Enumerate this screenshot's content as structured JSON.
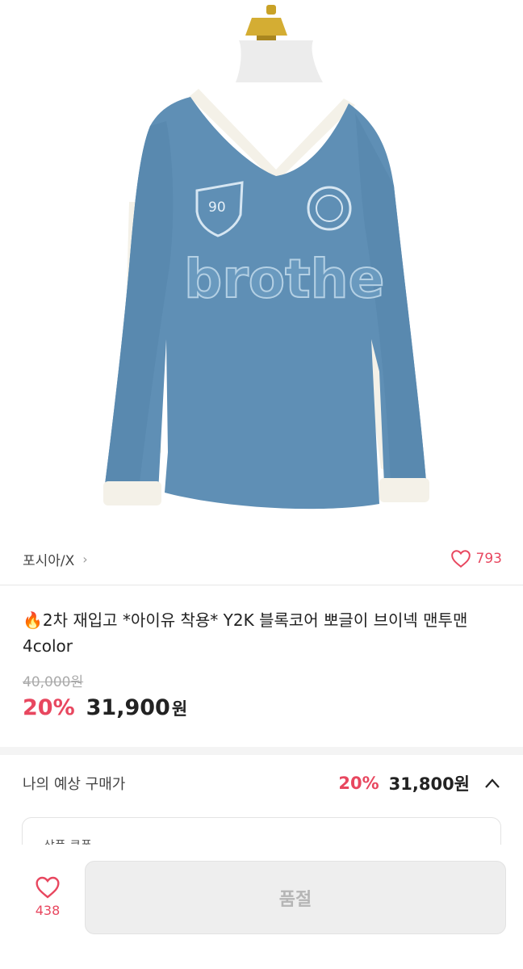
{
  "product_image": {
    "icon": "sweater-product-photo",
    "print_text": "brothe",
    "badge_number": "90"
  },
  "store": {
    "name": "포시아/X",
    "chevron": "›",
    "like_count": "793"
  },
  "product": {
    "title": "🔥2차 재입고 *아이유 착용* Y2K 블록코어 뽀글이 브이넥 맨투맨 4color",
    "original_price": "40,000원",
    "discount": "20%",
    "price": "31,900",
    "price_unit": "원"
  },
  "expected": {
    "label": "나의 예상 구매가",
    "discount": "20%",
    "price": "31,800원"
  },
  "coupon": {
    "text": "상품 쿠폰"
  },
  "bottom_bar": {
    "wish_count": "438",
    "button_label": "품절"
  },
  "colors": {
    "accent": "#e8475f",
    "sweater": "#5f8fb5"
  }
}
